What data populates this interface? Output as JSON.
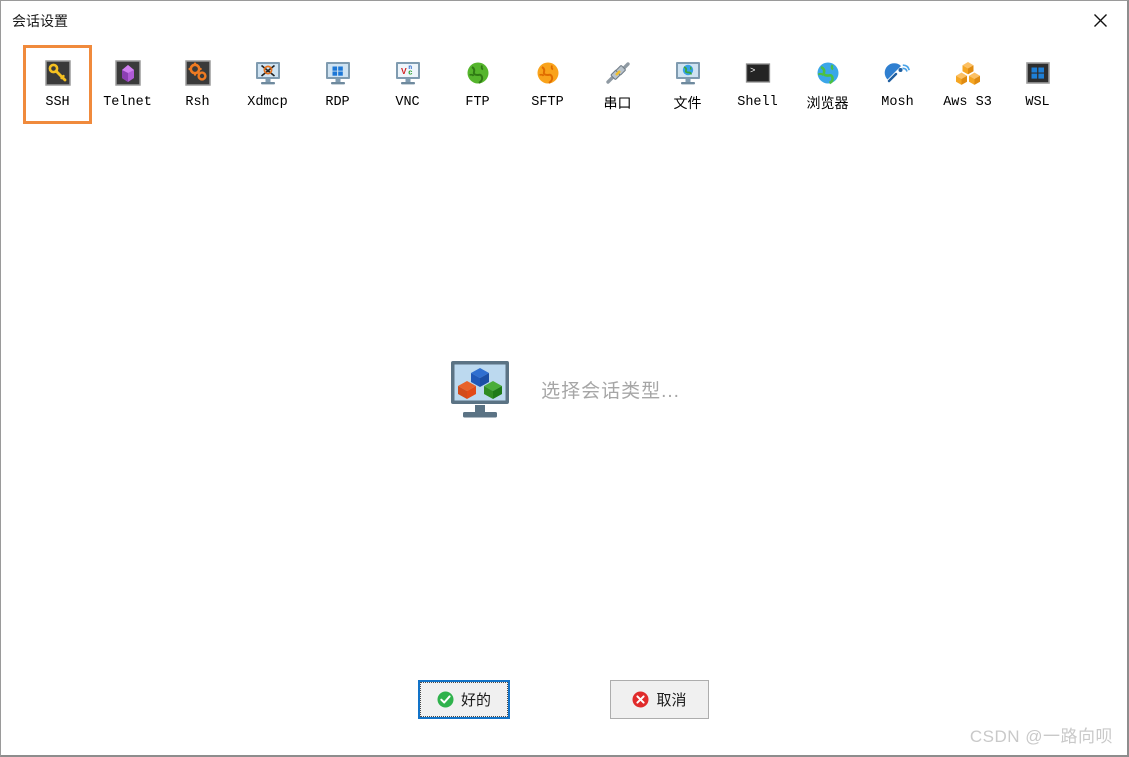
{
  "window": {
    "title": "会话设置",
    "close_icon": "close-icon"
  },
  "session_types": [
    {
      "label": "SSH",
      "icon": "key-icon",
      "selected": true,
      "cjk": false
    },
    {
      "label": "Telnet",
      "icon": "purple-gem-icon",
      "selected": false,
      "cjk": false
    },
    {
      "label": "Rsh",
      "icon": "gears-icon",
      "selected": false,
      "cjk": false
    },
    {
      "label": "Xdmcp",
      "icon": "x-monitor-icon",
      "selected": false,
      "cjk": false
    },
    {
      "label": "RDP",
      "icon": "windows-monitor-icon",
      "selected": false,
      "cjk": false
    },
    {
      "label": "VNC",
      "icon": "vnc-monitor-icon",
      "selected": false,
      "cjk": false
    },
    {
      "label": "FTP",
      "icon": "green-globe-icon",
      "selected": false,
      "cjk": false
    },
    {
      "label": "SFTP",
      "icon": "orange-globe-icon",
      "selected": false,
      "cjk": false
    },
    {
      "label": "串口",
      "icon": "serial-plug-icon",
      "selected": false,
      "cjk": true
    },
    {
      "label": "文件",
      "icon": "globe-monitor-icon",
      "selected": false,
      "cjk": true
    },
    {
      "label": "Shell",
      "icon": "terminal-icon",
      "selected": false,
      "cjk": false
    },
    {
      "label": "浏览器",
      "icon": "blue-globe-icon",
      "selected": false,
      "cjk": true
    },
    {
      "label": "Mosh",
      "icon": "satellite-dish-icon",
      "selected": false,
      "cjk": false
    },
    {
      "label": "Aws S3",
      "icon": "aws-cubes-icon",
      "selected": false,
      "cjk": false
    },
    {
      "label": "WSL",
      "icon": "wsl-icon",
      "selected": false,
      "cjk": false
    }
  ],
  "placeholder": {
    "text": "选择会话类型...",
    "icon": "monitor-cubes-icon"
  },
  "footer": {
    "ok_label": "好的",
    "ok_icon": "green-check-icon",
    "cancel_label": "取消",
    "cancel_icon": "red-x-icon"
  },
  "watermark": "CSDN @一路向呗",
  "colors": {
    "selection": "#f08a3c",
    "focus_border": "#1273c8",
    "button_face": "#f0f0f0",
    "ok_accent": "#2fb24c",
    "cancel_accent": "#e02b2b",
    "placeholder_text": "#a6a6a6",
    "watermark_text": "#c9c9c9"
  }
}
